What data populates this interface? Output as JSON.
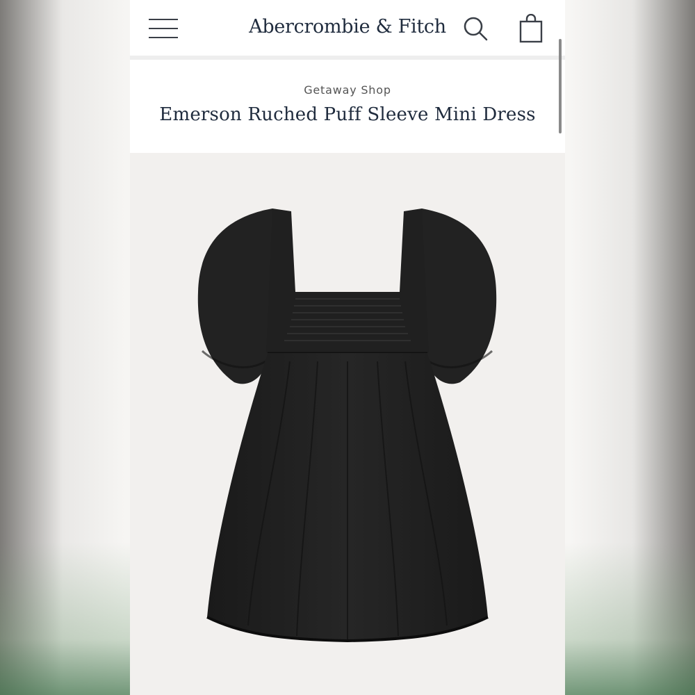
{
  "header": {
    "brand": "Abercrombie & Fitch",
    "menu_icon": "hamburger-menu-icon",
    "search_icon": "search-icon",
    "bag_icon": "shopping-bag-icon"
  },
  "product": {
    "category": "Getaway Shop",
    "title": "Emerson Ruched Puff Sleeve Mini Dress",
    "color": "#1f1f1f"
  },
  "colors": {
    "brand_navy": "#1f2b3d",
    "header_bg": "#ffffff",
    "image_bg": "#f2f0ee"
  }
}
